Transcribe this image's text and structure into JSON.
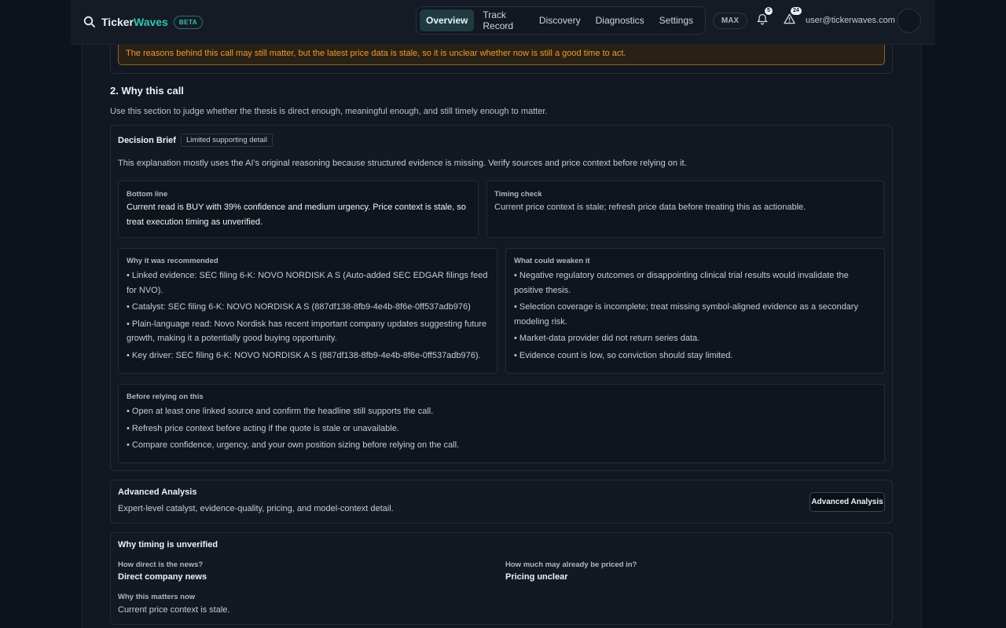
{
  "nav": {
    "brand_prefix": "Ticker",
    "brand_accent": "Waves",
    "beta": "BETA",
    "tabs": [
      {
        "label": "Overview",
        "active": true
      },
      {
        "label": "Track Record"
      },
      {
        "label": "Discovery"
      },
      {
        "label": "Diagnostics"
      },
      {
        "label": "Settings"
      }
    ],
    "plan": "MAX",
    "notifications_count": "5",
    "alerts_count": "24",
    "user_email": "user@tickerwaves.com"
  },
  "warning": "The reasons behind this call may still matter, but the latest price data is stale, so it is unclear whether now is still a good time to act.",
  "section": {
    "title": "2. Why this call",
    "description": "Use this section to judge whether the thesis is direct enough, meaningful enough, and still timely enough to matter."
  },
  "decision_brief": {
    "title": "Decision Brief",
    "tag": "Limited supporting detail",
    "intro": "This explanation mostly uses the AI's original reasoning because structured evidence is missing. Verify sources and price context before relying on it.",
    "bottom_line": {
      "label": "Bottom line",
      "text": "Current read is BUY with 39% confidence and medium urgency. Price context is stale, so treat execution timing as unverified."
    },
    "timing_check": {
      "label": "Timing check",
      "text": "Current price context is stale; refresh price data before treating this as actionable."
    },
    "why_recommended": {
      "label": "Why it was recommended",
      "items": [
        "• Linked evidence: SEC filing 6-K: NOVO NORDISK A S (Auto-added SEC EDGAR filings feed for NVO).",
        "• Catalyst: SEC filing 6-K: NOVO NORDISK A S (887df138-8fb9-4e4b-8f6e-0ff537adb976)",
        "• Plain-language read: Novo Nordisk has recent important company updates suggesting future growth, making it a potentially good buying opportunity.",
        "• Key driver: SEC filing 6-K: NOVO NORDISK A S (887df138-8fb9-4e4b-8f6e-0ff537adb976)."
      ]
    },
    "weaken": {
      "label": "What could weaken it",
      "items": [
        "• Negative regulatory outcomes or disappointing clinical trial results would invalidate the positive thesis.",
        "• Selection coverage is incomplete; treat missing symbol-aligned evidence as a secondary modeling risk.",
        "• Market-data provider did not return series data.",
        "• Evidence count is low, so conviction should stay limited."
      ]
    },
    "before_relying": {
      "label": "Before relying on this",
      "items": [
        "• Open at least one linked source and confirm the headline still supports the call.",
        "• Refresh price context before acting if the quote is stale or unavailable.",
        "• Compare confidence, urgency, and your own position sizing before relying on the call."
      ]
    }
  },
  "advanced": {
    "title": "Advanced Analysis",
    "desc": "Expert-level catalyst, evidence-quality, pricing, and model-context detail.",
    "button": "Advanced Analysis"
  },
  "timing": {
    "title": "Why timing is unverified",
    "direct_label": "How direct is the news?",
    "direct_value": "Direct company news",
    "priced_label": "How much may already be priced in?",
    "priced_value": "Pricing unclear",
    "matters_label": "Why this matters now",
    "matters_value": "Current price context is stale."
  }
}
